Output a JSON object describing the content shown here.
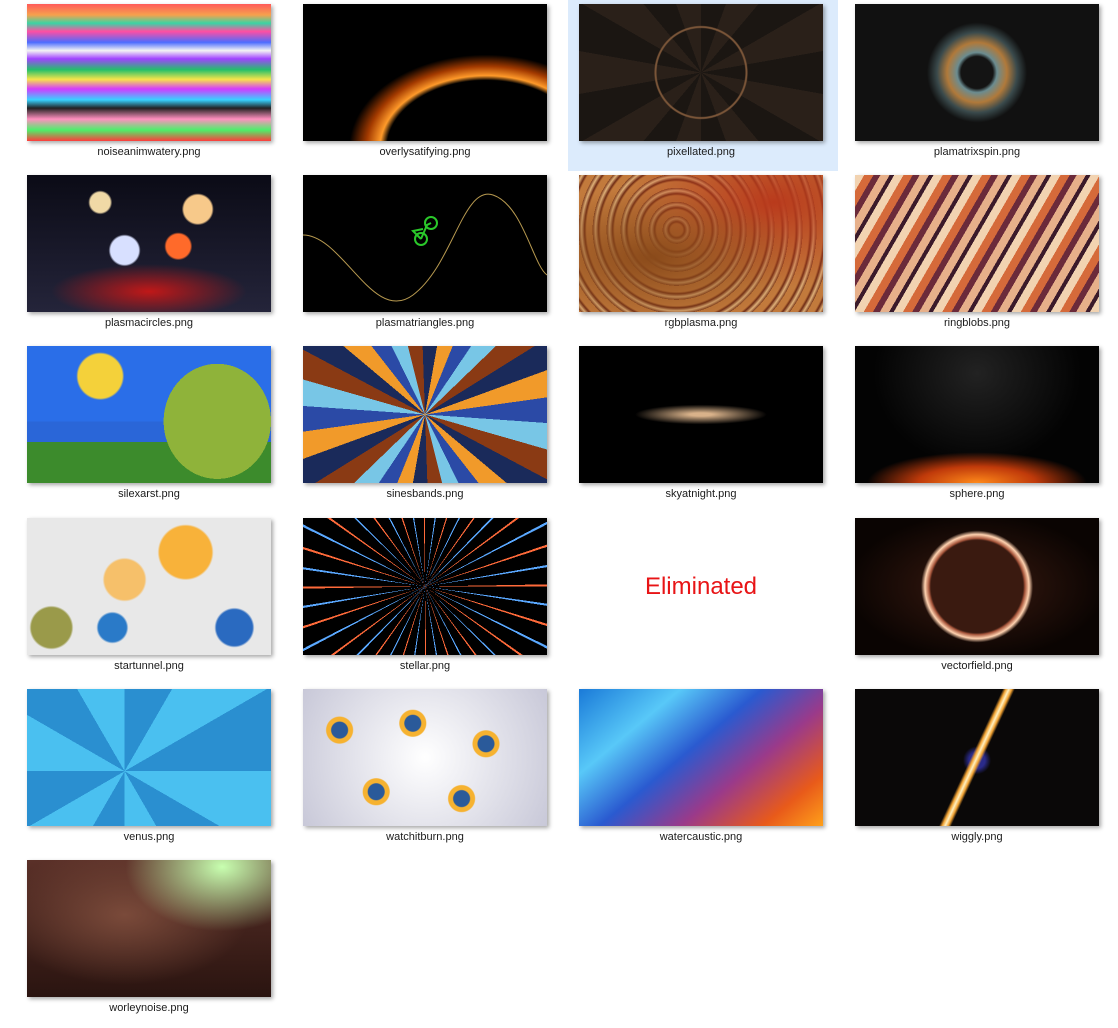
{
  "files": [
    {
      "name": "noiseanimwatery.png",
      "icon": "image-thumbnail"
    },
    {
      "name": "overlysatifying.png",
      "icon": "image-thumbnail"
    },
    {
      "name": "pixellated.png",
      "icon": "image-thumbnail",
      "selected": true
    },
    {
      "name": "plamatrixspin.png",
      "icon": "image-thumbnail"
    },
    {
      "name": "plasmacircles.png",
      "icon": "image-thumbnail"
    },
    {
      "name": "plasmatriangles.png",
      "icon": "image-thumbnail"
    },
    {
      "name": "rgbplasma.png",
      "icon": "image-thumbnail"
    },
    {
      "name": "ringblobs.png",
      "icon": "image-thumbnail"
    },
    {
      "name": "silexarst.png",
      "icon": "image-thumbnail"
    },
    {
      "name": "sinesbands.png",
      "icon": "image-thumbnail"
    },
    {
      "name": "skyatnight.png",
      "icon": "image-thumbnail"
    },
    {
      "name": "sphere.png",
      "icon": "image-thumbnail"
    },
    {
      "name": "startunnel.png",
      "icon": "image-thumbnail"
    },
    {
      "name": "stellar.png",
      "icon": "image-thumbnail"
    },
    {
      "name": "",
      "annotation": "Eliminated",
      "annotation_color": "#e81416"
    },
    {
      "name": "vectorfield.png",
      "icon": "image-thumbnail"
    },
    {
      "name": "venus.png",
      "icon": "image-thumbnail"
    },
    {
      "name": "watchitburn.png",
      "icon": "image-thumbnail"
    },
    {
      "name": "watercaustic.png",
      "icon": "image-thumbnail"
    },
    {
      "name": "wiggly.png",
      "icon": "image-thumbnail"
    },
    {
      "name": "worleynoise.png",
      "icon": "image-thumbnail"
    }
  ],
  "selection_color": "#dcebfc"
}
